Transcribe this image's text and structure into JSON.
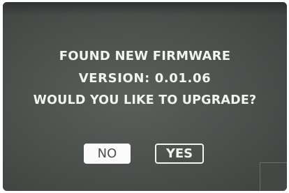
{
  "dialog": {
    "title": "FOUND NEW FIRMWARE",
    "version_line": "VERSION: 0.01.06",
    "question": "WOULD YOU LIKE TO UPGRADE?"
  },
  "buttons": {
    "no_label": "NO",
    "yes_label": "YES"
  },
  "colors": {
    "screen_background": "#4b504d",
    "text": "#f4f4f0",
    "selected_button_bg": "#fbfbfb"
  }
}
